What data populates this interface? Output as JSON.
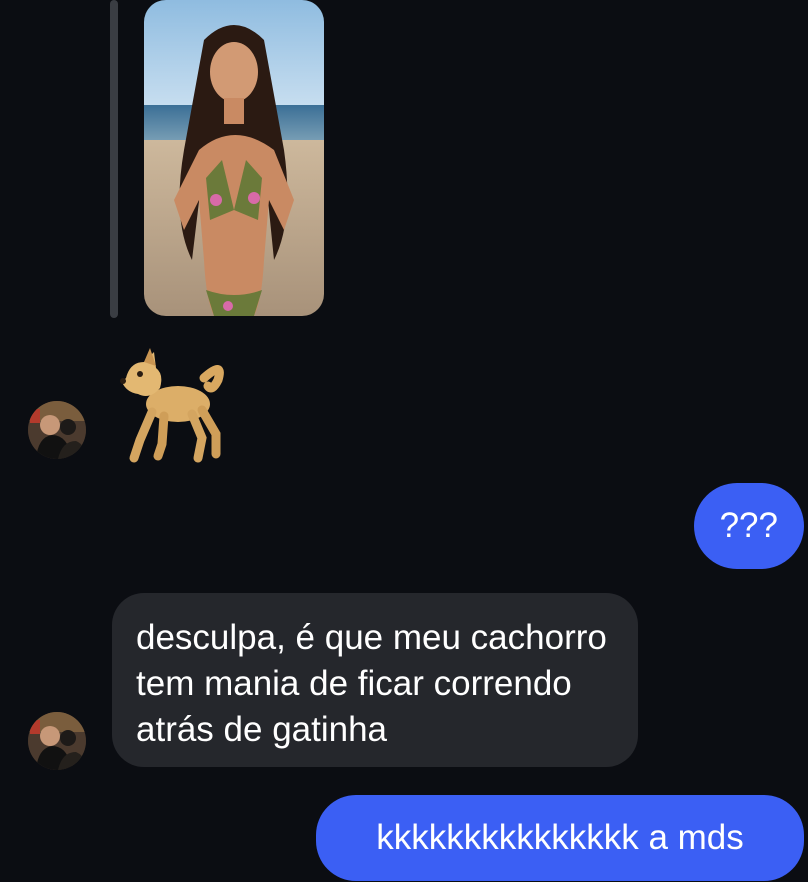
{
  "thread": {
    "messages": [
      {
        "type": "photo",
        "sender": "other",
        "description_icon": "beach-photo"
      },
      {
        "type": "emoji",
        "sender": "other",
        "emoji_icon": "dog-emoji"
      },
      {
        "type": "text",
        "sender": "me",
        "text": "???"
      },
      {
        "type": "text",
        "sender": "other",
        "lines": [
          "desculpa, é que meu cachorro",
          "tem mania de ficar correndo",
          "atrás de gatinha"
        ]
      },
      {
        "type": "text",
        "sender": "me",
        "text": "kkkkkkkkkkkkkkk a mds"
      }
    ]
  },
  "colors": {
    "background": "#0b0d12",
    "sent_bubble": "#3b5ff4",
    "sent_bubble_last": "#1e6ff2",
    "received_bubble": "#25272c",
    "reply_bar": "#3a3d43"
  }
}
